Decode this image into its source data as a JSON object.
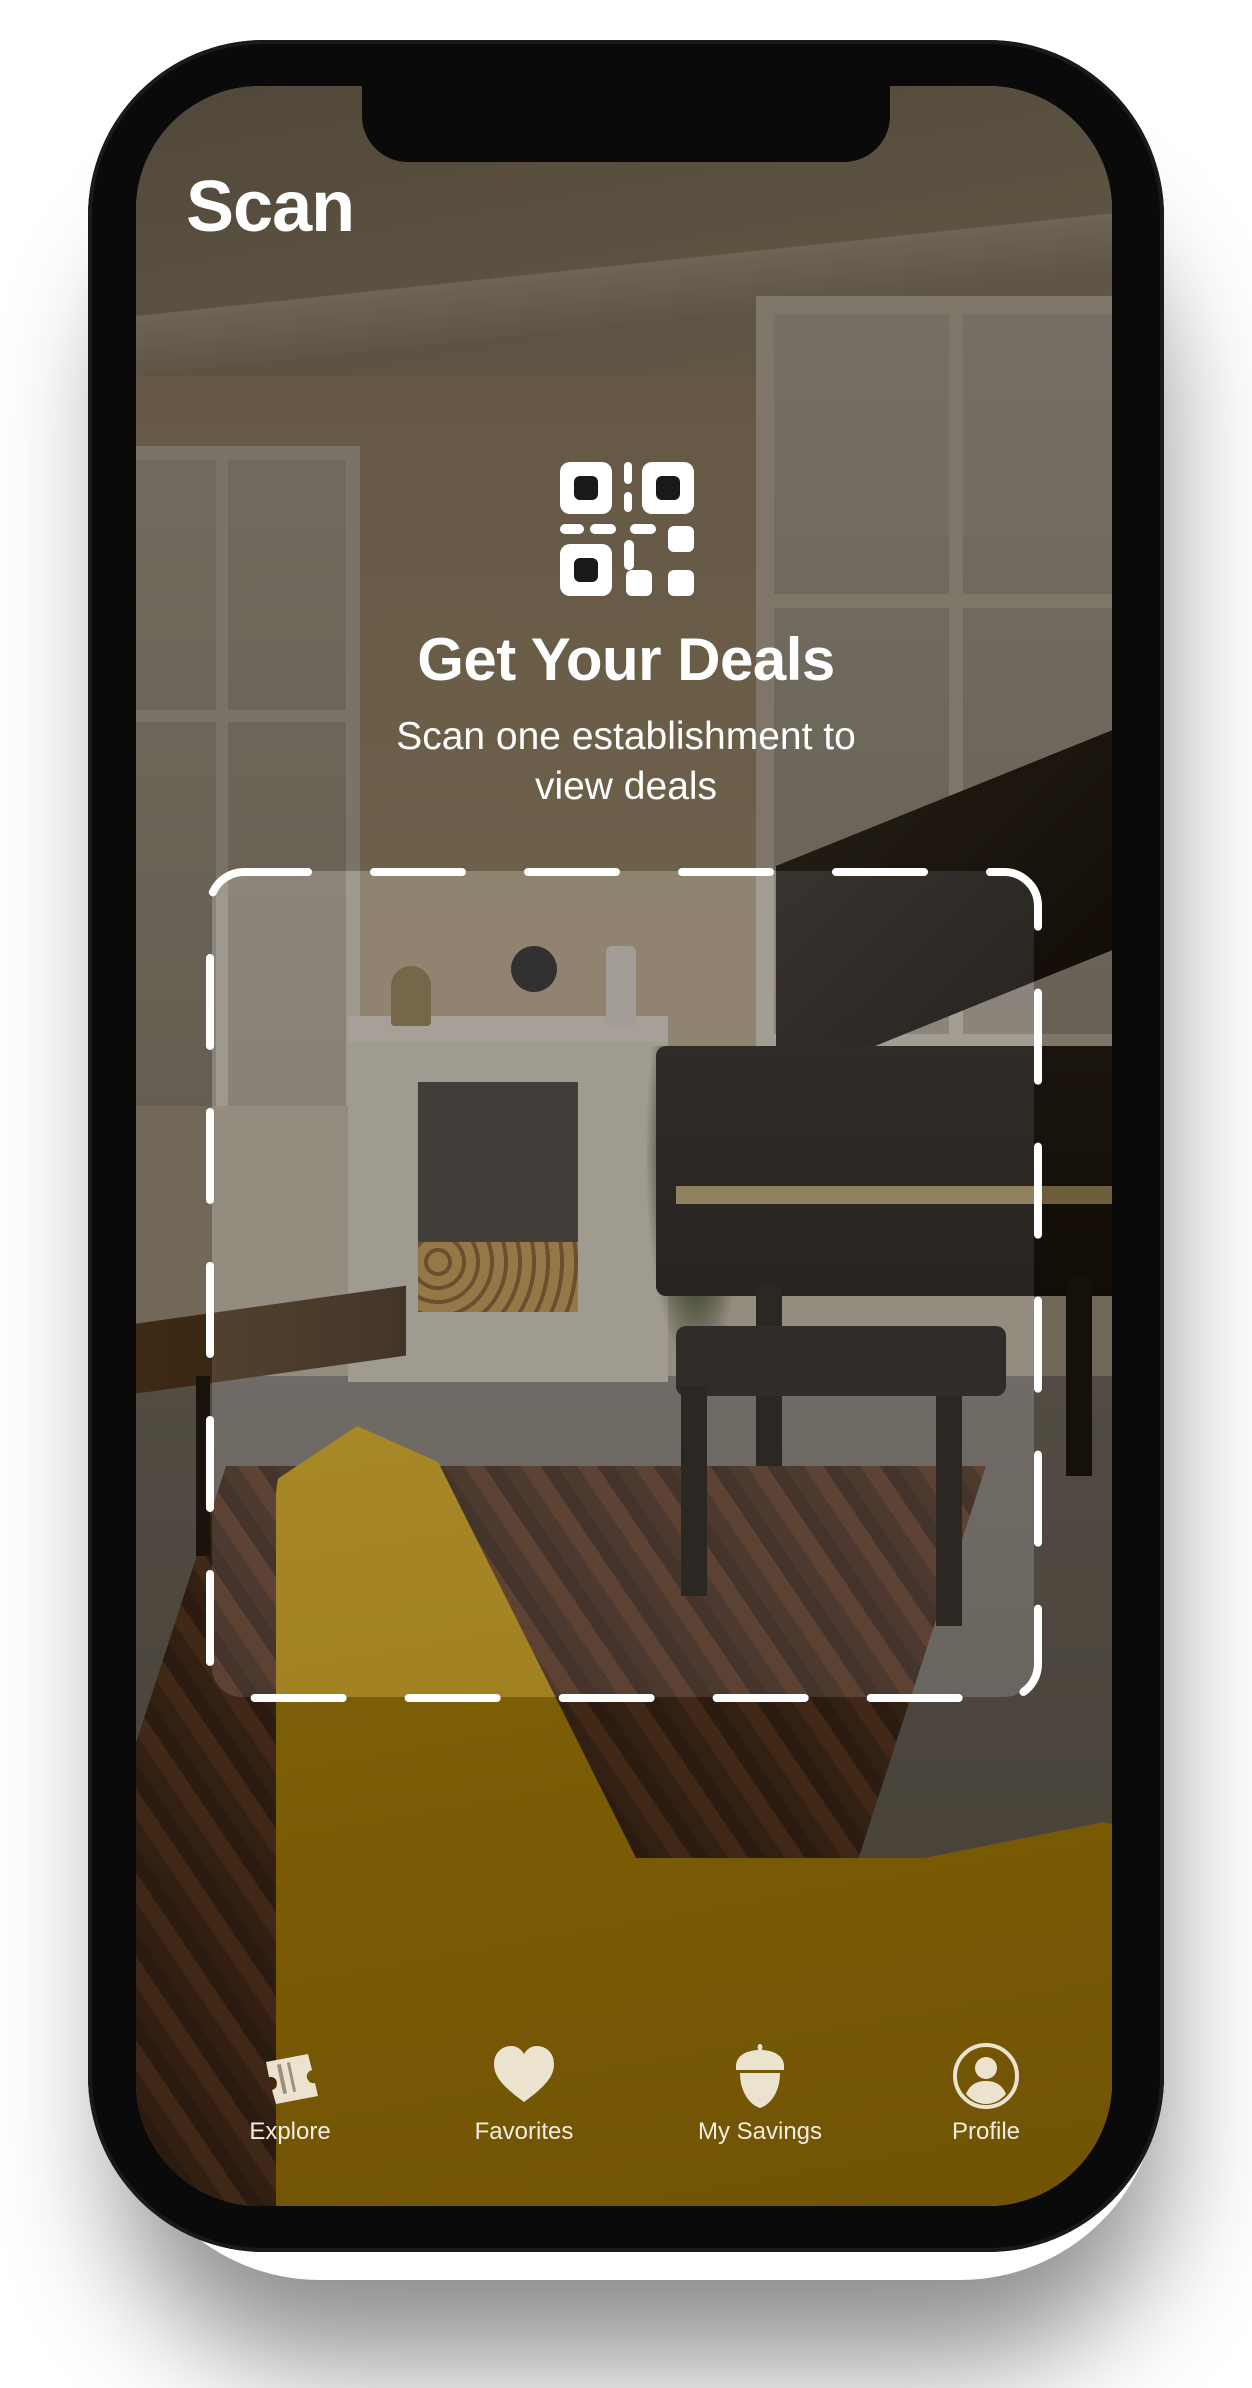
{
  "header": {
    "title": "Scan"
  },
  "hero": {
    "icon": "qr-code-icon",
    "title": "Get Your Deals",
    "subtitle": "Scan one establishment to view deals"
  },
  "scanner": {
    "frame_style": "dashed-rounded",
    "frame_color": "#ffffff"
  },
  "tabbar": {
    "items": [
      {
        "label": "Explore",
        "icon": "tickets-icon"
      },
      {
        "label": "Favorites",
        "icon": "heart-icon"
      },
      {
        "label": "My Savings",
        "icon": "acorn-icon"
      },
      {
        "label": "Profile",
        "icon": "profile-icon"
      }
    ],
    "icon_color": "#ece3cf"
  }
}
